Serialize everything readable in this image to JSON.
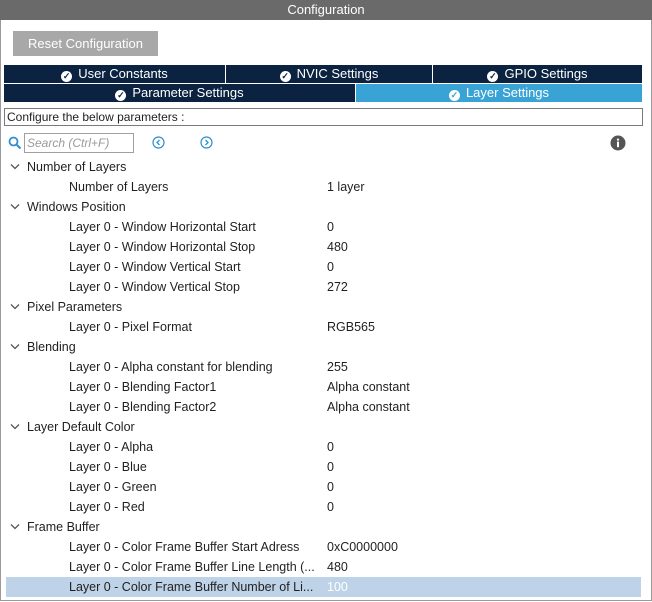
{
  "window": {
    "title": "Configuration"
  },
  "toolbar": {
    "reset_label": "Reset Configuration"
  },
  "tabs_row1": [
    {
      "label": "User Constants",
      "active": false
    },
    {
      "label": "NVIC Settings",
      "active": false
    },
    {
      "label": "GPIO Settings",
      "active": false
    }
  ],
  "tabs_row2": [
    {
      "label": "Parameter Settings",
      "active": false
    },
    {
      "label": "Layer Settings",
      "active": true
    }
  ],
  "config_label": "Configure the below parameters :",
  "search": {
    "placeholder": "Search (Ctrl+F)",
    "value": ""
  },
  "colors": {
    "tab_dark": "#0b2340",
    "tab_active": "#3aa3d5",
    "selected_row": "#bed3e8",
    "title_bar": "#6a6a6a"
  },
  "icons": [
    "search-icon",
    "previous-icon",
    "next-icon",
    "info-icon",
    "chevron-down-icon",
    "check-icon"
  ],
  "tree": {
    "groups": [
      {
        "label": "Number of Layers",
        "params": [
          {
            "label": "Number of Layers",
            "value": "1 layer"
          }
        ]
      },
      {
        "label": "Windows Position",
        "params": [
          {
            "label": "Layer 0 - Window Horizontal Start",
            "value": "0"
          },
          {
            "label": "Layer 0 - Window Horizontal Stop",
            "value": "480"
          },
          {
            "label": "Layer 0 - Window Vertical Start",
            "value": "0"
          },
          {
            "label": "Layer 0 - Window Vertical Stop",
            "value": "272"
          }
        ]
      },
      {
        "label": "Pixel Parameters",
        "params": [
          {
            "label": "Layer 0 - Pixel Format",
            "value": "RGB565"
          }
        ]
      },
      {
        "label": "Blending",
        "params": [
          {
            "label": "Layer 0 - Alpha constant for blending",
            "value": "255"
          },
          {
            "label": "Layer 0 - Blending Factor1",
            "value": "Alpha constant"
          },
          {
            "label": "Layer 0 - Blending Factor2",
            "value": "Alpha constant"
          }
        ]
      },
      {
        "label": "Layer Default Color",
        "params": [
          {
            "label": "Layer 0 - Alpha",
            "value": "0"
          },
          {
            "label": "Layer 0 - Blue",
            "value": "0"
          },
          {
            "label": "Layer 0 - Green",
            "value": "0"
          },
          {
            "label": "Layer 0 - Red",
            "value": "0"
          }
        ]
      },
      {
        "label": "Frame Buffer",
        "params": [
          {
            "label": "Layer 0 - Color Frame Buffer Start Adress",
            "value": "0xC0000000"
          },
          {
            "label": "Layer 0 - Color Frame Buffer Line Length (...",
            "value": "480"
          },
          {
            "label": "Layer 0 - Color Frame Buffer Number of Li...",
            "value": "100",
            "selected": true
          }
        ]
      }
    ]
  }
}
